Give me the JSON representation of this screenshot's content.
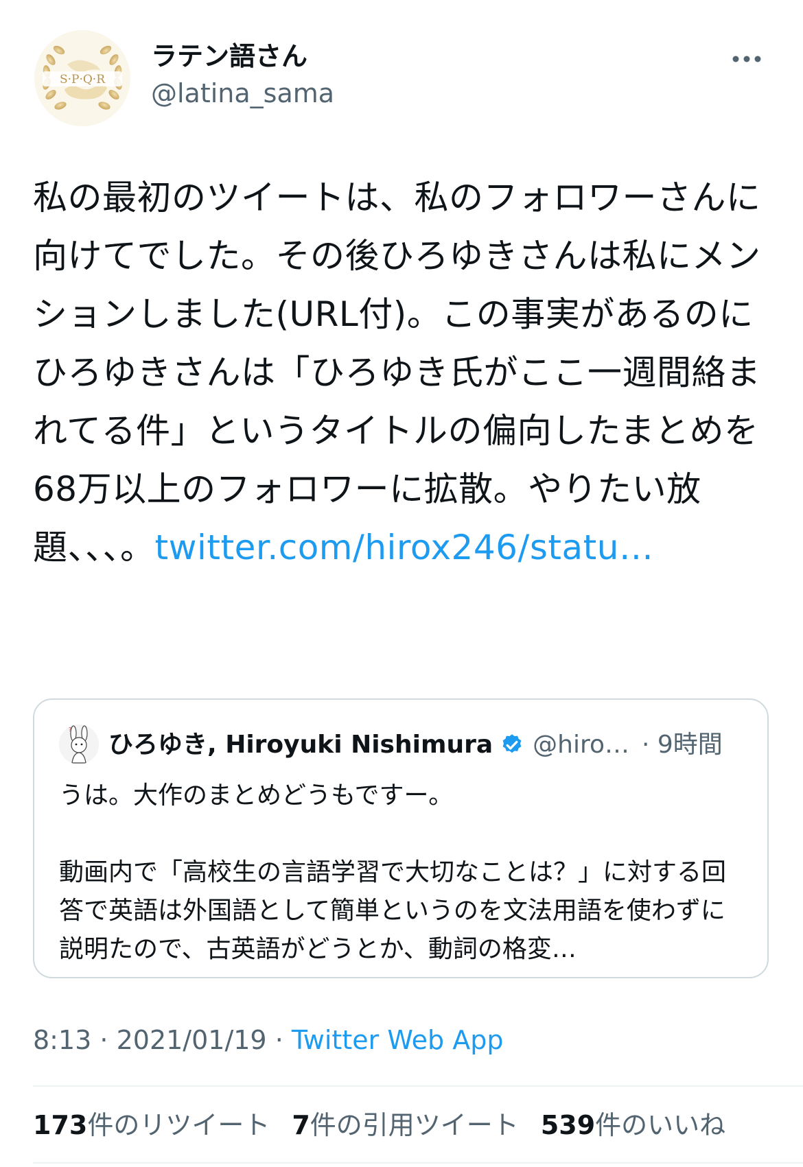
{
  "author": {
    "display_name": "ラテン語さん",
    "handle": "@latina_sama",
    "avatar_icon": "spqr-laurel-avatar",
    "avatar_letters": "S·P·Q·R"
  },
  "more_icon": "more-horizontal-icon",
  "tweet": {
    "text_before_link": "私の最初のツイートは、私のフォロワーさんに向けてでした。その後ひろゆきさんは私にメンションしました(URL付)。この事実があるのにひろゆきさんは「ひろゆき氏がここ一週間絡まれてる件」というタイトルの偏向したまとめを68万以上のフォロワーに拡散。やりたい放題、、、。",
    "link_text": "twitter.com/hirox246/statu…"
  },
  "quoted_tweet": {
    "display_name": "ひろゆき, Hiroyuki Nishimura",
    "handle": "@hiro…",
    "time": "· 9時間",
    "verified_icon": "verified-badge-icon",
    "text_line1": "うは。大作のまとめどうもですー。",
    "text_para2": "動画内で「高校生の言語学習で大切なことは？」に対する回答で英語は外国語として簡単というのを文法用語を使わずに説明たので、古英語がどうとか、動詞の格変…"
  },
  "meta": {
    "time": "8:13",
    "sep1": " · ",
    "date": "2021/01/19",
    "sep2": " · ",
    "source": "Twitter Web App"
  },
  "stats": {
    "retweets_num": "173",
    "retweets_label": "件のリツイート",
    "quotes_num": "7",
    "quotes_label": "件の引用ツイート",
    "likes_num": "539",
    "likes_label": "件のいいね"
  },
  "colors": {
    "link": "#1d9bf0",
    "secondary": "#536471",
    "border": "#cfd9de",
    "gold": "#c9a45c"
  }
}
